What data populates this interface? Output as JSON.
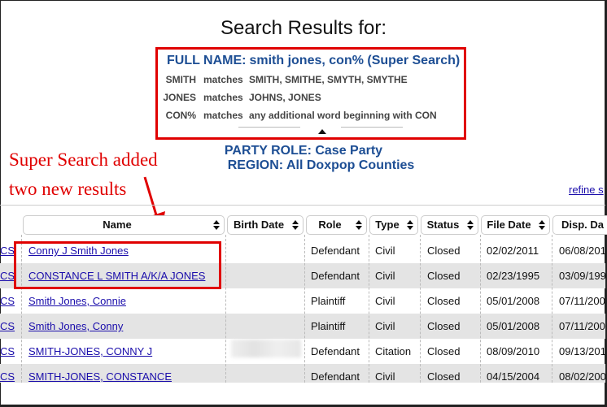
{
  "header": {
    "title": "Search Results for:"
  },
  "criteria": {
    "full_name_label": "FULL NAME:",
    "full_name_value": "smith jones, con% (Super Search)",
    "matches": [
      {
        "term": "SMITH",
        "word": "matches",
        "value": "SMITH, SMITHE, SMYTH, SMYTHE"
      },
      {
        "term": "JONES",
        "word": "matches",
        "value": "JOHNS, JONES"
      },
      {
        "term": "CON%",
        "word": "matches",
        "value": "any additional word beginning with CON"
      }
    ]
  },
  "party_role": "PARTY ROLE: Case Party",
  "region": "REGION: All Doxpop Counties",
  "annotation": {
    "line1": "Super Search added",
    "line2": "two new results"
  },
  "refine_link": "refine s",
  "table": {
    "columns": [
      "Name",
      "Birth Date",
      "Role",
      "Type",
      "Status",
      "File Date",
      "Disp. Da"
    ],
    "rows": [
      {
        "case": "CS",
        "name": "Conny J Smith Jones",
        "birth": "",
        "role": "Defendant",
        "type": "Civil",
        "status": "Closed",
        "file_date": "02/02/2011",
        "disp_date": "06/08/201"
      },
      {
        "case": "CS",
        "name": "CONSTANCE L SMITH A/K/A JONES",
        "birth": "",
        "role": "Defendant",
        "type": "Civil",
        "status": "Closed",
        "file_date": "02/23/1995",
        "disp_date": "03/09/199"
      },
      {
        "case": "CS",
        "name": "Smith Jones, Connie",
        "birth": "",
        "role": "Plaintiff",
        "type": "Civil",
        "status": "Closed",
        "file_date": "05/01/2008",
        "disp_date": "07/11/200"
      },
      {
        "case": "CS",
        "name": "Smith Jones, Conny",
        "birth": "",
        "role": "Plaintiff",
        "type": "Civil",
        "status": "Closed",
        "file_date": "05/01/2008",
        "disp_date": "07/11/200"
      },
      {
        "case": "CS",
        "name": "SMITH-JONES, CONNY J",
        "birth": "",
        "role": "Defendant",
        "type": "Citation",
        "status": "Closed",
        "file_date": "08/09/2010",
        "disp_date": "09/13/201"
      },
      {
        "case": "CS",
        "name": "SMITH-JONES, CONSTANCE",
        "birth": "",
        "role": "Defendant",
        "type": "Civil",
        "status": "Closed",
        "file_date": "04/15/2004",
        "disp_date": "08/02/200"
      }
    ]
  },
  "colors": {
    "criteria_blue": "#1d4e94",
    "highlight_red": "#e00000",
    "link_blue": "#1a0dab",
    "row_alt": "#e4e4e4"
  }
}
